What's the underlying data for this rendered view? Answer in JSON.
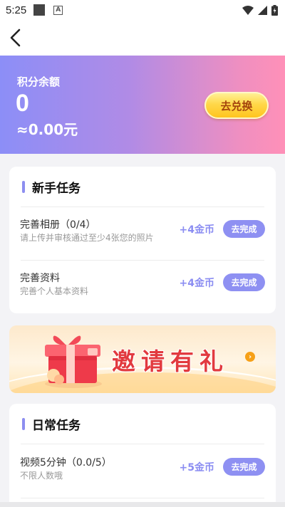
{
  "status_bar": {
    "time": "5:25"
  },
  "header": {
    "balance_label": "积分余额",
    "balance_value": "0",
    "balance_money": "≈0.00元",
    "exchange_label": "去兑换"
  },
  "newbie": {
    "title": "新手任务",
    "tasks": [
      {
        "name": "完善相册（0/4）",
        "desc": "请上传并审核通过至少4张您的照片",
        "reward": "+4金币",
        "button": "去完成"
      },
      {
        "name": "完善资料",
        "desc": "完善个人基本资料",
        "reward": "+4金币",
        "button": "去完成"
      }
    ]
  },
  "banner": {
    "text": "邀请有礼",
    "arrow": "›"
  },
  "daily": {
    "title": "日常任务",
    "tasks": [
      {
        "name": "视频5分钟（0.0/5）",
        "desc": "不限人数哦",
        "reward": "+5金币",
        "button": "去完成"
      }
    ]
  },
  "colors": {
    "accent": "#8e90f2",
    "gold_button": "#ffd84a",
    "banner_red": "#e23a3f"
  }
}
